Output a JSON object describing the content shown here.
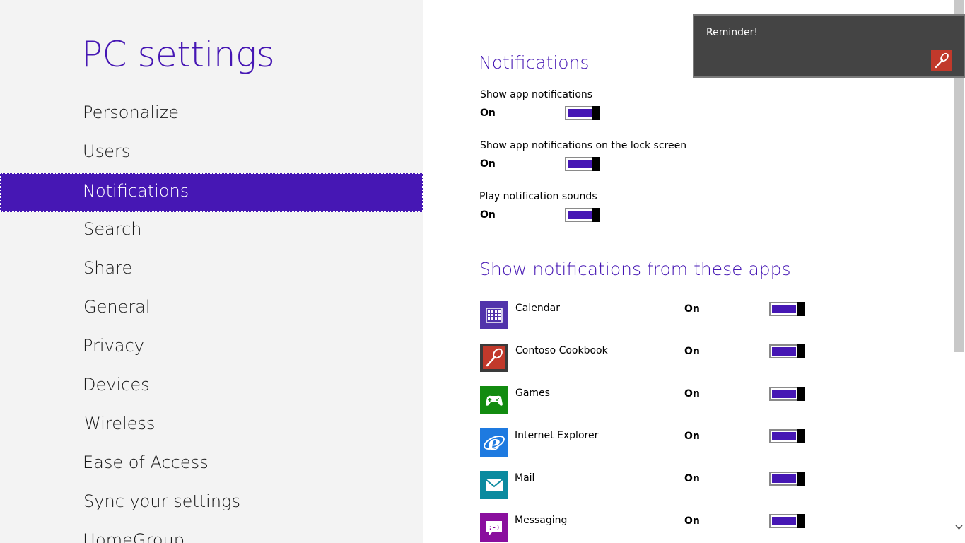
{
  "left": {
    "title": "PC settings",
    "nav": [
      {
        "label": "Personalize"
      },
      {
        "label": "Users"
      },
      {
        "label": "Notifications",
        "selected": true
      },
      {
        "label": "Search"
      },
      {
        "label": "Share"
      },
      {
        "label": "General"
      },
      {
        "label": "Privacy"
      },
      {
        "label": "Devices"
      },
      {
        "label": "Wireless"
      },
      {
        "label": "Ease of Access"
      },
      {
        "label": "Sync your settings"
      },
      {
        "label": "HomeGroup"
      }
    ]
  },
  "notifications": {
    "title": "Notifications",
    "settings": [
      {
        "label": "Show app notifications",
        "state": "On",
        "on": true
      },
      {
        "label": "Show app notifications on the lock screen",
        "state": "On",
        "on": true
      },
      {
        "label": "Play notification sounds",
        "state": "On",
        "on": true
      }
    ]
  },
  "apps_section": {
    "title": "Show notifications from these apps",
    "apps": [
      {
        "name": "Calendar",
        "state": "On",
        "on": true,
        "icon": "calendar-icon",
        "color": "#5133ab"
      },
      {
        "name": "Contoso Cookbook",
        "state": "On",
        "on": true,
        "icon": "cookbook-spoon-icon",
        "color": "#3a3a3a"
      },
      {
        "name": "Games",
        "state": "On",
        "on": true,
        "icon": "game-controller-icon",
        "color": "#128b10"
      },
      {
        "name": "Internet Explorer",
        "state": "On",
        "on": true,
        "icon": "internet-explorer-icon",
        "color": "#1e7ae0"
      },
      {
        "name": "Mail",
        "state": "On",
        "on": true,
        "icon": "mail-envelope-icon",
        "color": "#0a8a9f"
      },
      {
        "name": "Messaging",
        "state": "On",
        "on": true,
        "icon": "messaging-bubble-icon",
        "color": "#8a0f9e"
      }
    ]
  },
  "toast": {
    "text": "Reminder!",
    "icon": "cookbook-spoon-icon",
    "color": "#c1392b"
  },
  "colors": {
    "accent": "#4617b4",
    "left_bg": "#f3f3f3"
  }
}
